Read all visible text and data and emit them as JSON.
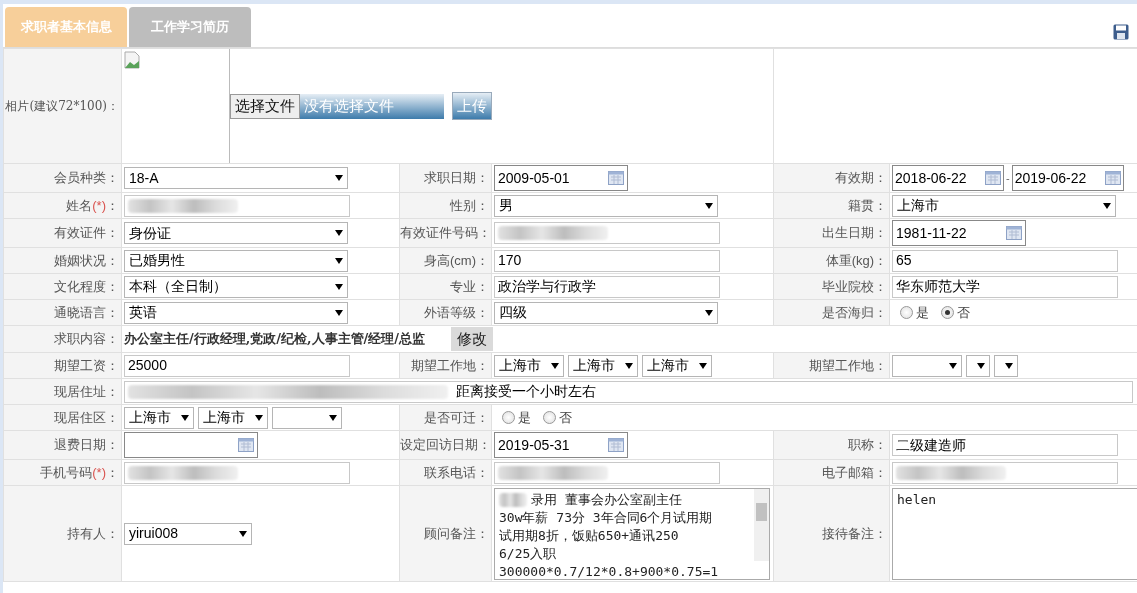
{
  "tabs": [
    {
      "label": "求职者基本信息",
      "selected": true
    },
    {
      "label": "工作学习简历",
      "selected": false
    }
  ],
  "photo": {
    "label": "相片(建议72*100)：",
    "file_button": "选择文件",
    "file_status": "没有选择文件",
    "upload_button": "上传"
  },
  "rows": [
    [
      {
        "label": "会员种类：",
        "field": {
          "kind": "select",
          "value": "18-A"
        }
      },
      {
        "label": "求职日期：",
        "field": {
          "kind": "date",
          "value": "2009-05-01"
        }
      },
      {
        "label": "有效期：",
        "field": {
          "kind": "date_range",
          "from": "2018-06-22",
          "separator": "-",
          "to": "2019-06-22"
        }
      }
    ],
    [
      {
        "label": "姓名",
        "required_mark": "(*)",
        "label_end": "：",
        "field": {
          "kind": "redacted"
        }
      },
      {
        "label": "性别：",
        "field": {
          "kind": "select",
          "value": "男"
        }
      },
      {
        "label": "籍贯：",
        "field": {
          "kind": "select",
          "value": "上海市"
        }
      }
    ],
    [
      {
        "label": "有效证件：",
        "field": {
          "kind": "select",
          "value": "身份证"
        }
      },
      {
        "label": "有效证件号码：",
        "field": {
          "kind": "redacted"
        }
      },
      {
        "label": "出生日期：",
        "field": {
          "kind": "date",
          "value": "1981-11-22"
        }
      }
    ],
    [
      {
        "label": "婚姻状况：",
        "field": {
          "kind": "select",
          "value": "已婚男性"
        }
      },
      {
        "label": "身高(cm)：",
        "field": {
          "kind": "text",
          "value": "170"
        }
      },
      {
        "label": "体重(kg)：",
        "field": {
          "kind": "text",
          "value": "65"
        }
      }
    ],
    [
      {
        "label": "文化程度：",
        "field": {
          "kind": "select",
          "value": "本科（全日制）"
        }
      },
      {
        "label": "专业：",
        "field": {
          "kind": "text",
          "value": "政治学与行政学"
        }
      },
      {
        "label": "毕业院校：",
        "field": {
          "kind": "text",
          "value": "华东师范大学"
        }
      }
    ],
    [
      {
        "label": "通晓语言：",
        "field": {
          "kind": "select",
          "value": "英语"
        }
      },
      {
        "label": "外语等级：",
        "field": {
          "kind": "select",
          "value": "四级"
        }
      },
      {
        "label": "是否海归：",
        "field": {
          "kind": "radio",
          "options": [
            {
              "label": "是",
              "selected": false
            },
            {
              "label": "否",
              "selected": true
            }
          ]
        }
      }
    ],
    [
      {
        "label": "求职内容：",
        "field": {
          "kind": "jobs",
          "value": "办公室主任/行政经理,党政/纪检,人事主管/经理/总监",
          "button": "修改"
        }
      }
    ],
    [
      {
        "label": "期望工资：",
        "field": {
          "kind": "text",
          "value": "25000"
        }
      },
      {
        "label": "期望工作地：",
        "field": {
          "kind": "select_group",
          "selects": [
            {
              "kind": "filled",
              "value": "上海市"
            },
            {
              "kind": "filled",
              "value": "上海市"
            },
            {
              "kind": "filled",
              "value": "上海市"
            }
          ]
        }
      },
      {
        "label": "期望工作地：",
        "field": {
          "kind": "select_group",
          "selects": [
            {
              "kind": "blank"
            },
            {
              "kind": "narrow_blank"
            },
            {
              "kind": "narrow_blank"
            }
          ]
        }
      }
    ],
    [
      {
        "label": "现居住址：",
        "field": {
          "kind": "address",
          "value": "距离接受一个小时左右"
        }
      }
    ],
    [
      {
        "label": "现居住区：",
        "field": {
          "kind": "select_group",
          "selects": [
            {
              "kind": "filled",
              "value": "上海市"
            },
            {
              "kind": "filled",
              "value": "上海市"
            },
            {
              "kind": "blank"
            }
          ]
        }
      },
      {
        "label": "是否可迁：",
        "field": {
          "kind": "radio",
          "options": [
            {
              "label": "是",
              "selected": false
            },
            {
              "label": "否",
              "selected": false
            }
          ]
        }
      }
    ],
    [
      {
        "label": "退费日期：",
        "field": {
          "kind": "date"
        }
      },
      {
        "label": "设定回访日期：",
        "field": {
          "kind": "date",
          "value": "2019-05-31"
        }
      },
      {
        "label": "职称：",
        "field": {
          "kind": "text",
          "value": "二级建造师"
        }
      }
    ],
    [
      {
        "label": "手机号码",
        "required_mark": "(*)",
        "label_end": "：",
        "field": {
          "kind": "redacted"
        }
      },
      {
        "label": "联系电话：",
        "field": {
          "kind": "redacted"
        }
      },
      {
        "label": "电子邮箱：",
        "field": {
          "kind": "redacted"
        }
      }
    ],
    [
      {
        "label": "持有人：",
        "field": {
          "kind": "short_select",
          "value": "yirui008"
        }
      },
      {
        "label": "顾问备注：",
        "field": {
          "kind": "textarea",
          "lines": [
            "录用  董事会办公室副主任",
            "30w年薪  73分  3年合同6个月试用期",
            "试用期8折，饭贴650+通讯250",
            "6/25入职",
            "300000*0.7/12*0.8+900*0.75=1"
          ]
        }
      },
      {
        "label": "接待备注：",
        "field": {
          "kind": "textarea",
          "lines": [
            "helen"
          ]
        }
      }
    ]
  ]
}
